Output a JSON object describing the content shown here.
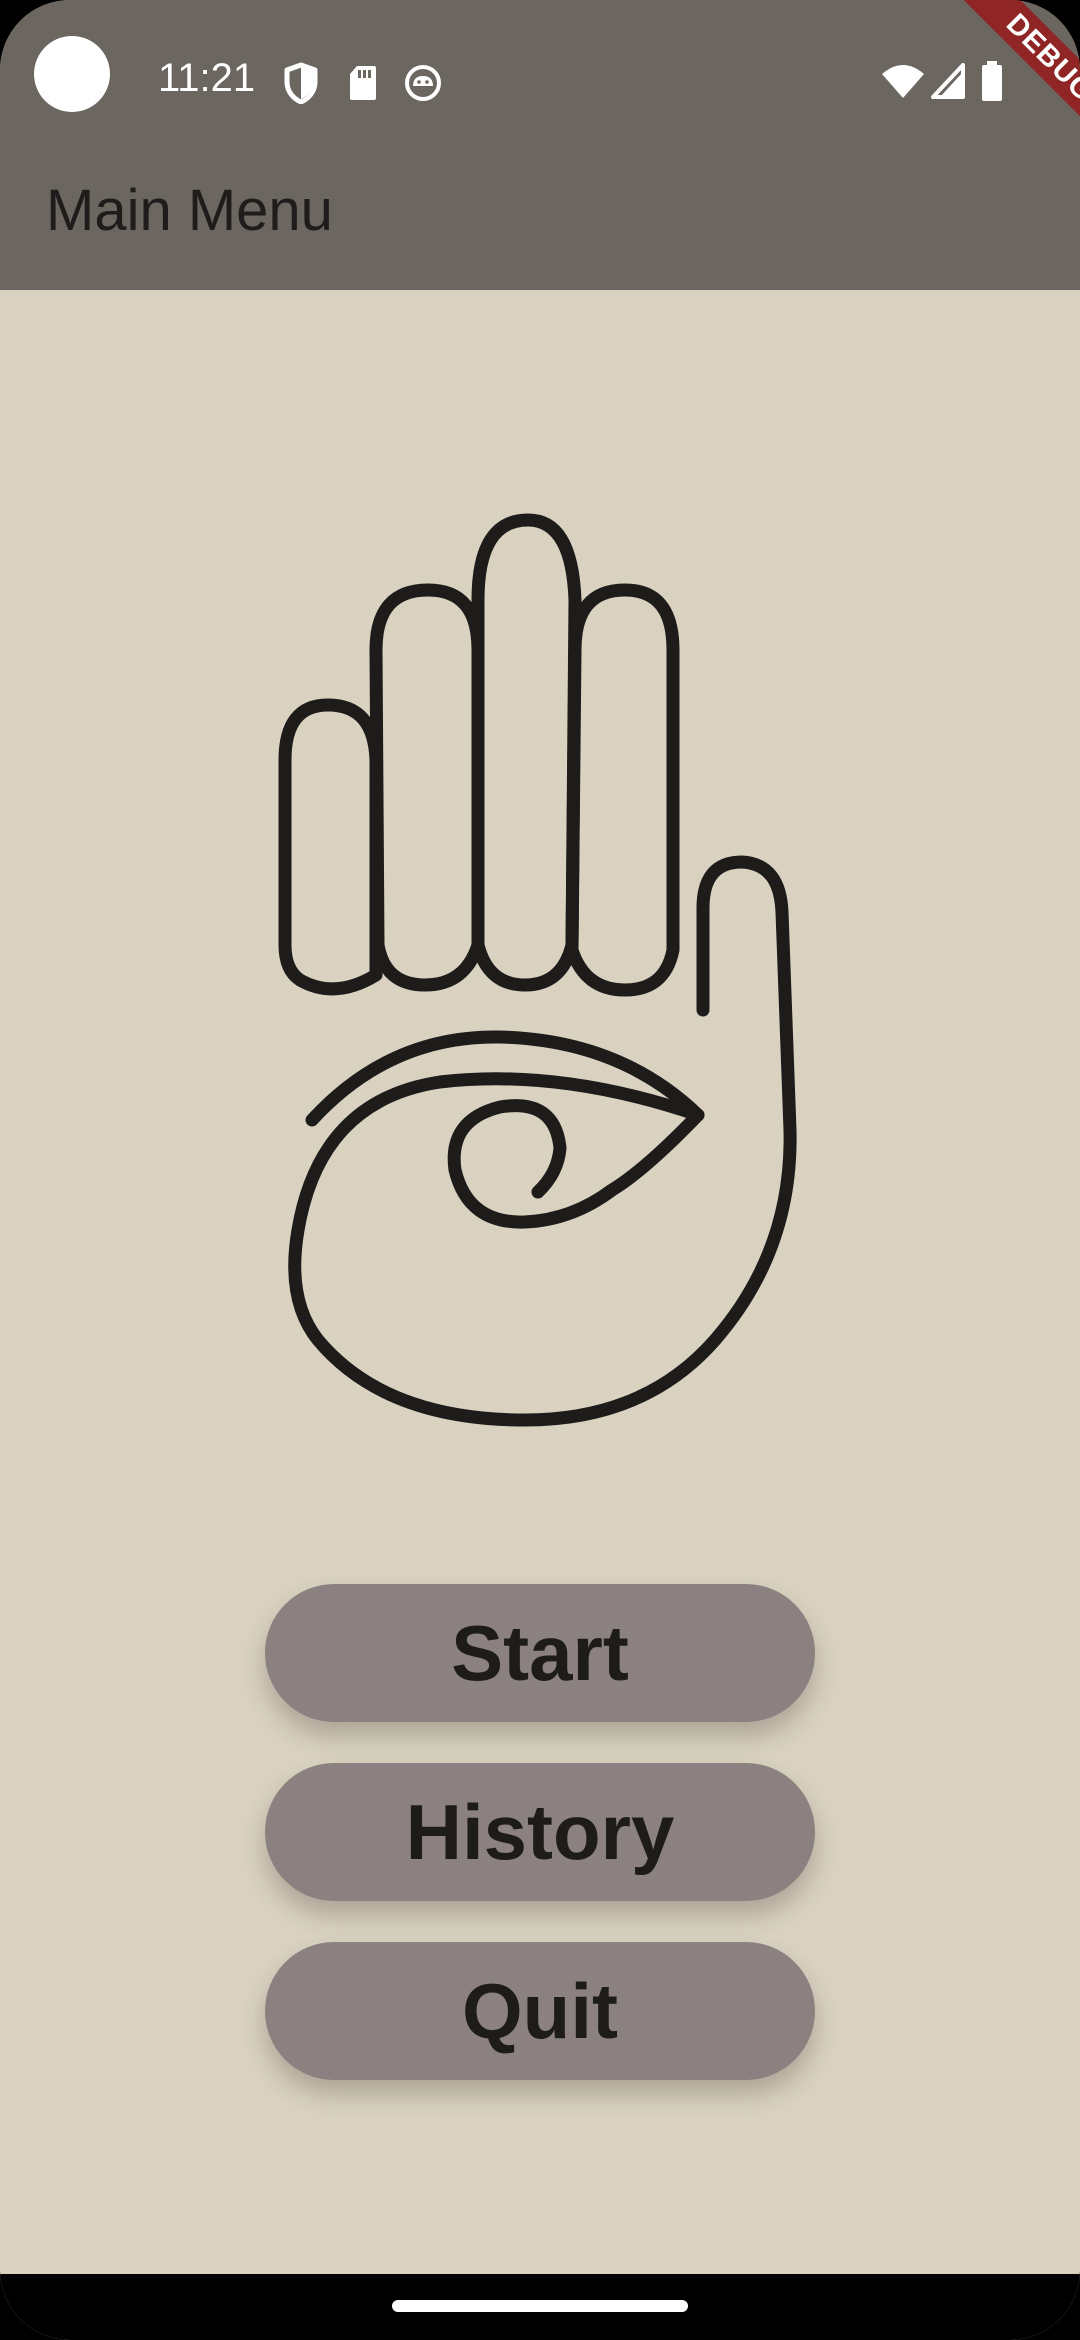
{
  "status_bar": {
    "time": "11:21",
    "left_icons": [
      "camera-cutout",
      "shield-icon",
      "sd-card-icon",
      "android-icon"
    ],
    "right_icons": [
      "wifi-icon",
      "signal-icon",
      "battery-icon"
    ]
  },
  "app_bar": {
    "title": "Main Menu",
    "background_color": "#6b6760"
  },
  "debug_banner": {
    "label": "DEBUG",
    "color": "#8f2525"
  },
  "logo": {
    "icon": "hand-eye-icon"
  },
  "menu": {
    "start_label": "Start",
    "history_label": "History",
    "quit_label": "Quit",
    "button_color": "#8a8180"
  },
  "theme": {
    "background": "#d9d2c1"
  }
}
